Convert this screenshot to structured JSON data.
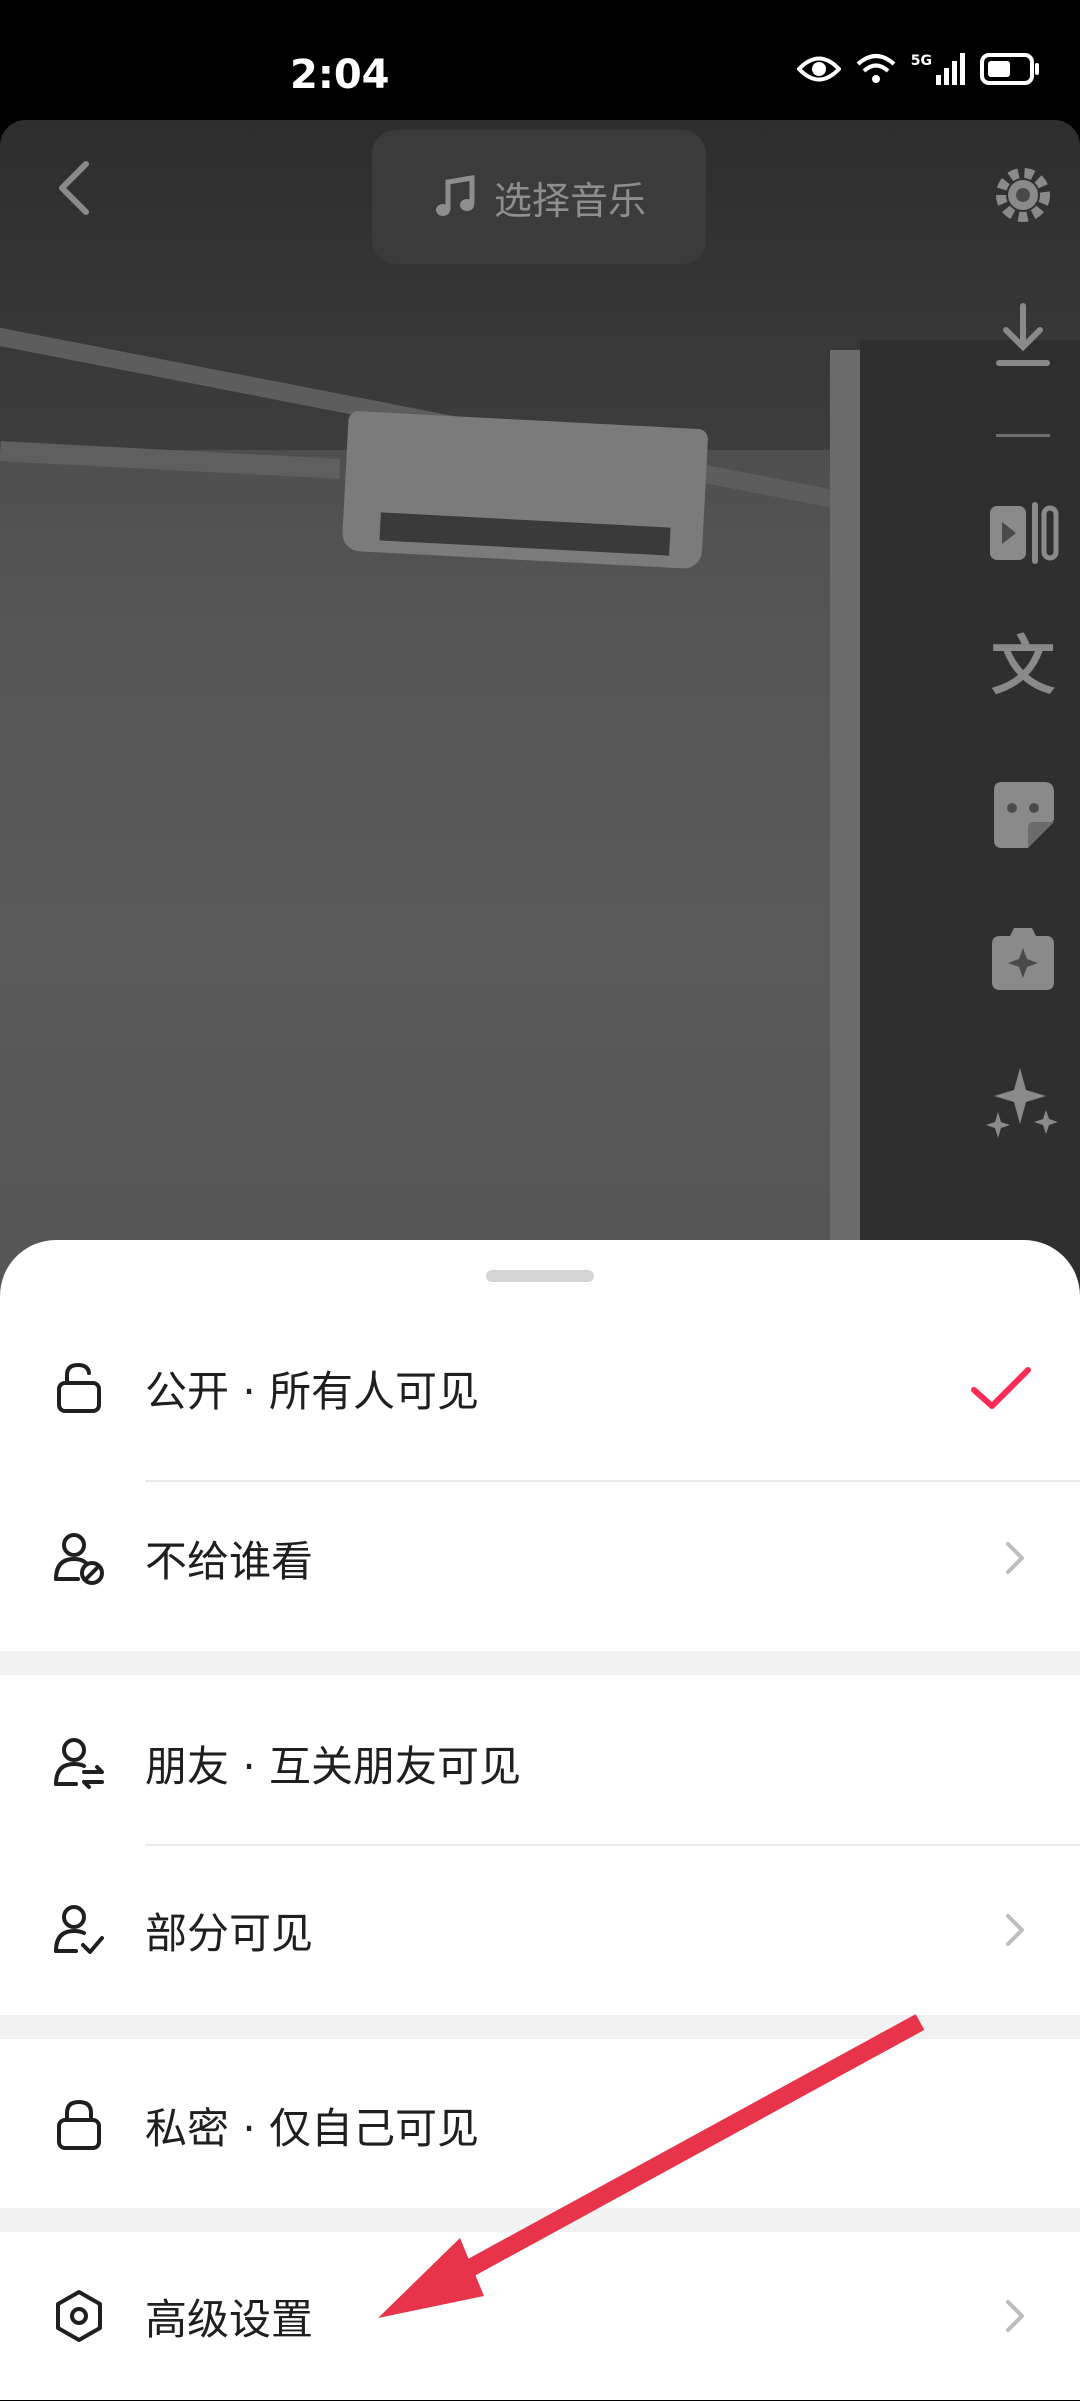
{
  "status_bar": {
    "time": "2:04",
    "network": "5G"
  },
  "top": {
    "music_label": "选择音乐"
  },
  "visibility_options": [
    {
      "label": "公开 · 所有人可见",
      "selected": true
    },
    {
      "label": "不给谁看"
    },
    {
      "label": "朋友 · 互关朋友可见"
    },
    {
      "label": "部分可见"
    },
    {
      "label": "私密 · 仅自己可见"
    },
    {
      "label": "高级设置"
    }
  ],
  "colors": {
    "accent": "#fe2c55",
    "annotation_arrow": "#e8344a"
  }
}
